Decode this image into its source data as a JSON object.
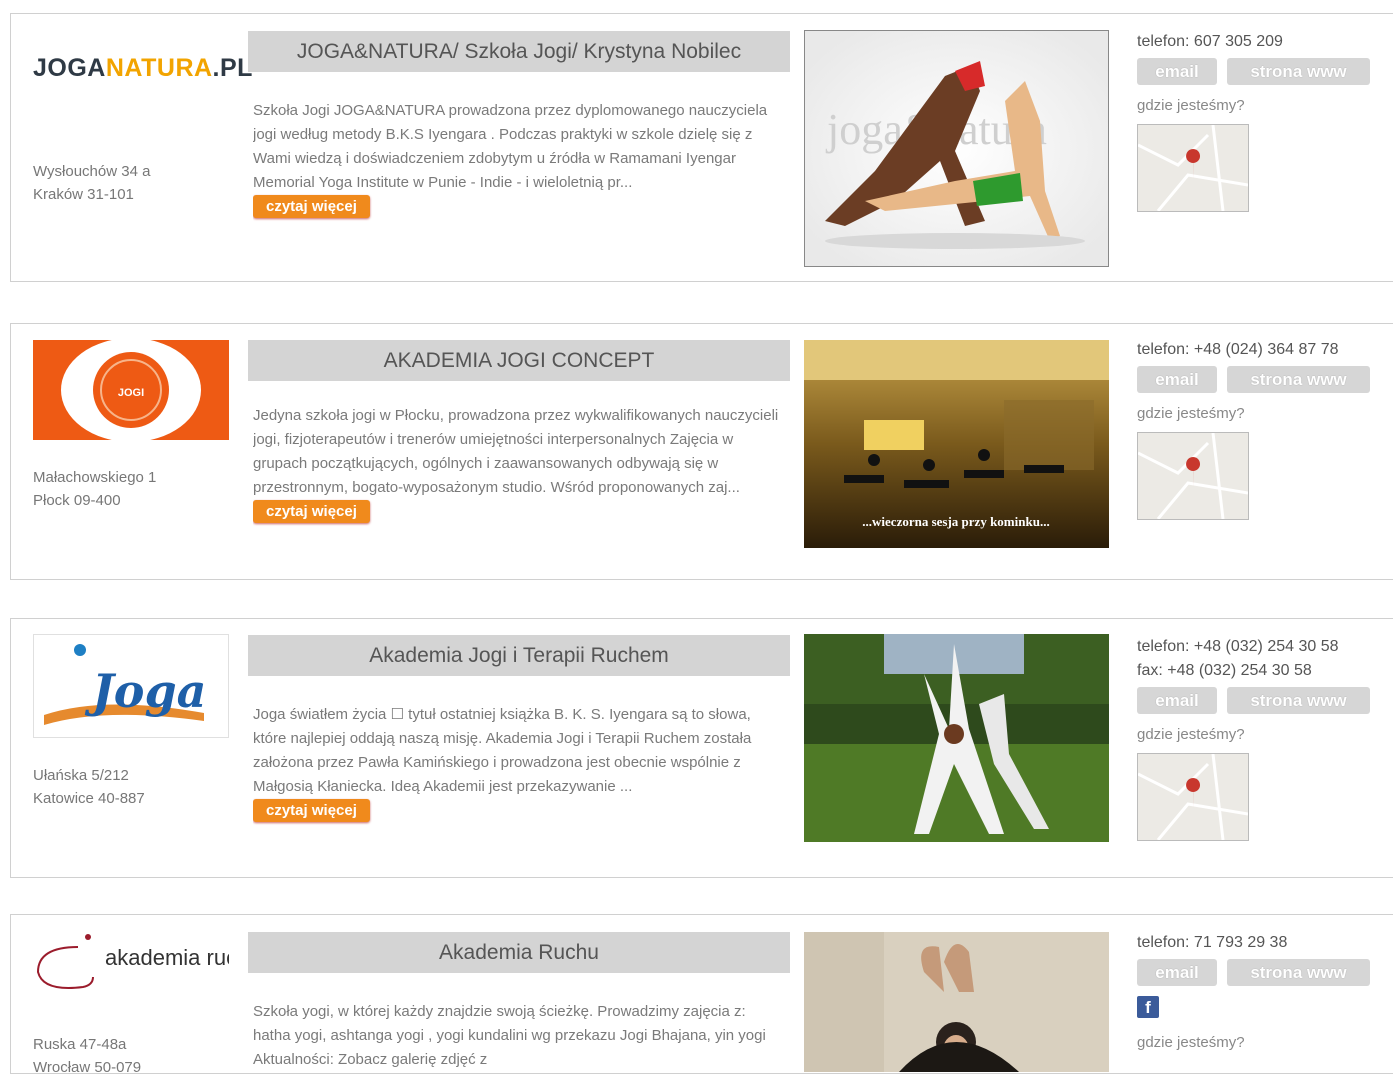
{
  "listings": [
    {
      "title": "JOGA&NATURA/ Szkoła Jogi/ Krystyna Nobilec",
      "logo_text_1": "JOGA",
      "logo_text_2": "NATURA",
      "logo_text_3": ".PL",
      "address_line1": "Wysłouchów 34 a",
      "address_line2": "Kraków 31-101",
      "description": "Szkoła Jogi JOGA&NATURA prowadzona przez dyplomowanego nauczyciela jogi według metody B.K.S Iyengara . Podczas praktyki w szkole dzielę się z Wami wiedzą i doświadczeniem zdobytym u źródła w Ramamani Iyengar Memorial Yoga Institute w Punie - Indie - i wieloletnią pr...",
      "read_more": "czytaj więcej",
      "photo_text": "joga&natura",
      "phone": "telefon: 607 305 209",
      "email": "email",
      "www": "strona www",
      "where": "gdzie jesteśmy?"
    },
    {
      "title": "AKADEMIA JOGI CONCEPT",
      "logo_text": "AKADEMIA JOGI CONCEPT",
      "address_line1": "Małachowskiego 1",
      "address_line2": "Płock 09-400",
      "description": "Jedyna szkoła jogi w Płocku, prowadzona przez wykwalifikowanych nauczycieli jogi, fizjoterapeutów i trenerów umiejętności interpersonalnych Zajęcia w grupach początkujących, ogólnych i zaawansowanych odbywają się w przestronnym, bogato-wyposażonym studio. Wśród proponowanych zaj...",
      "read_more": "czytaj więcej",
      "photo_caption": "...wieczorna sesja przy kominku...",
      "phone": "telefon: +48 (024) 364 87 78",
      "email": "email",
      "www": "strona www",
      "where": "gdzie jesteśmy?"
    },
    {
      "title": "Akademia Jogi i Terapii Ruchem",
      "logo_text": "Joga",
      "address_line1": "Ułańska 5/212",
      "address_line2": "Katowice 40-887",
      "description": "Joga światłem życia ☐ tytuł ostatniej książka B. K. S. Iyengara są to słowa, które najlepiej oddają naszą misję. Akademia Jogi i Terapii Ruchem została założona przez Pawła Kamińskiego i prowadzona jest obecnie wspólnie z Małgosią Kłaniecka. Ideą Akademii jest przekazywanie ...",
      "read_more": "czytaj więcej",
      "phone": "telefon: +48 (032) 254 30 58",
      "fax": "fax: +48 (032) 254 30 58",
      "email": "email",
      "www": "strona www",
      "where": "gdzie jesteśmy?"
    },
    {
      "title": "Akademia Ruchu",
      "logo_text": "akademia ruchu",
      "address_line1": "Ruska 47-48a",
      "address_line2": "Wrocław 50-079",
      "description": "Szkoła yogi, w której każdy znajdzie swoją ścieżkę. Prowadzimy zajęcia z: hatha yogi, ashtanga yogi , yogi kundalini wg przekazu Jogi Bhajana, yin yogi Aktualności: Zobacz galerię zdjęć z",
      "phone": "telefon: 71 793 29 38",
      "email": "email",
      "www": "strona www",
      "fb_icon_letter": "f",
      "where": "gdzie jesteśmy?"
    }
  ]
}
